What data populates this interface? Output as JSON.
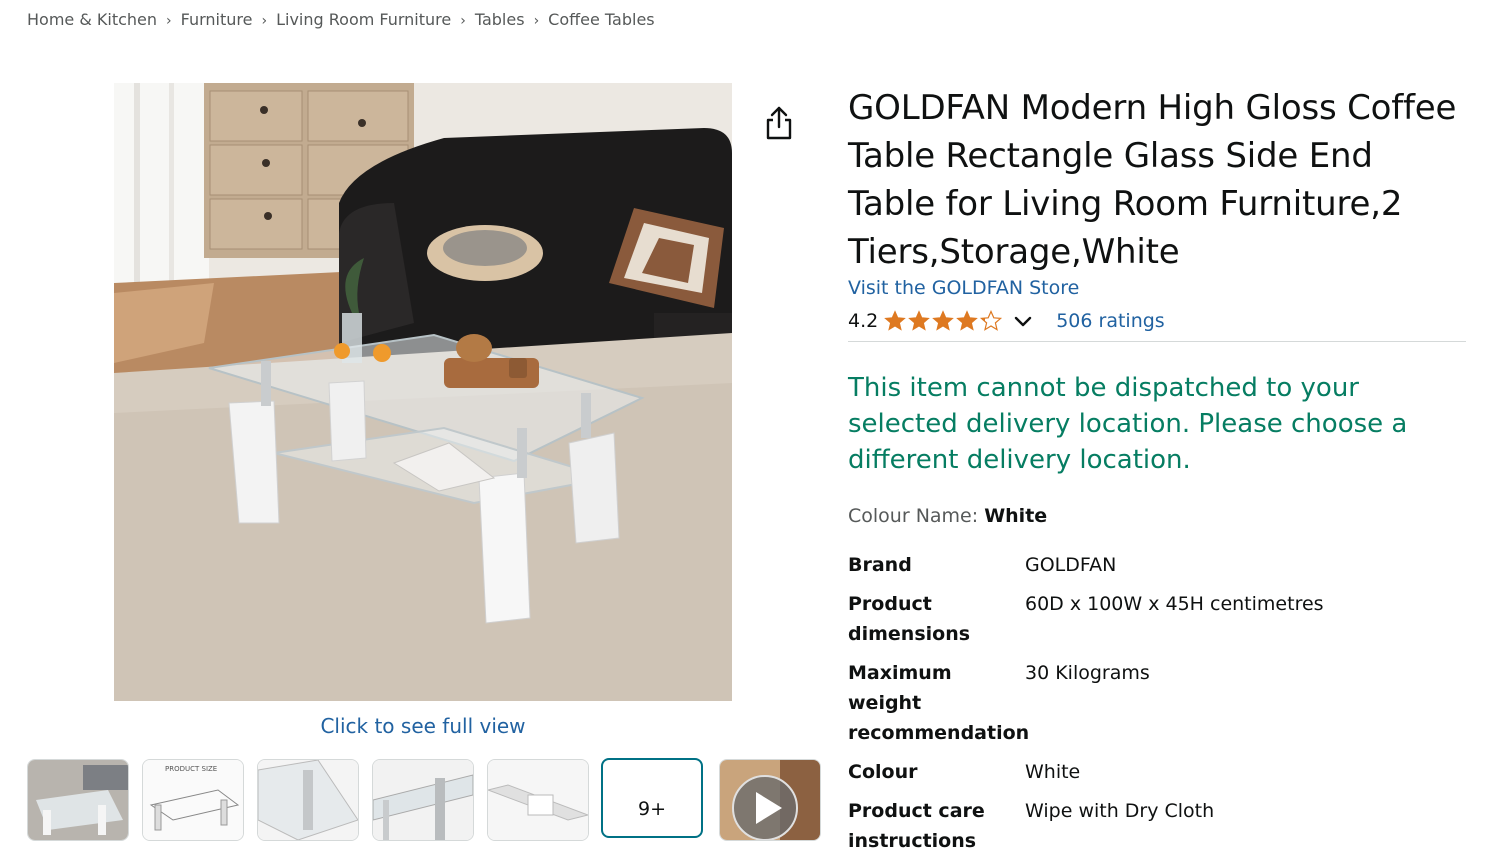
{
  "breadcrumb": [
    "Home & Kitchen",
    "Furniture",
    "Living Room Furniture",
    "Tables",
    "Coffee Tables"
  ],
  "breadcrumb_separator": "›",
  "gallery": {
    "full_view_label": "Click to see full view",
    "more_count_label": "9+"
  },
  "product": {
    "title": "GOLDFAN Modern High Gloss Coffee Table Rectangle Glass Side End Table for Living Room Furniture,2 Tiers,Storage,White",
    "store_link": "Visit the GOLDFAN Store",
    "rating": "4.2",
    "ratings_count": "506 ratings",
    "dispatch_message": "This item cannot be dispatched to your selected delivery location. Please choose a different delivery location.",
    "colour_label": "Colour Name:",
    "colour_value": "White"
  },
  "specs": [
    {
      "key": "Brand",
      "value": "GOLDFAN"
    },
    {
      "key": "Product dimensions",
      "value": "60D x 100W x 45H centimetres"
    },
    {
      "key": "Maximum weight recommendation",
      "value": "30 Kilograms"
    },
    {
      "key": "Colour",
      "value": "White"
    },
    {
      "key": "Product care instructions",
      "value": "Wipe with Dry Cloth"
    }
  ],
  "colors": {
    "link": "#2162a1",
    "star": "#de7921",
    "success": "#067d62",
    "selected_border": "#007185"
  },
  "icons": [
    "share-icon",
    "star-icon",
    "chevron-down-icon",
    "play-icon"
  ]
}
